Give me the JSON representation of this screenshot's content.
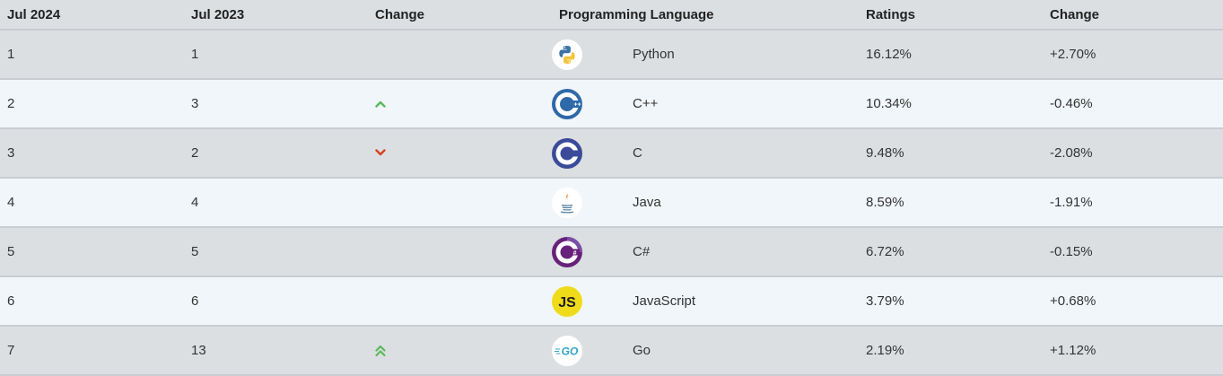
{
  "headers": {
    "current": "Jul 2024",
    "previous": "Jul 2023",
    "change": "Change",
    "language": "Programming Language",
    "ratings": "Ratings",
    "change_pct": "Change"
  },
  "rows": [
    {
      "current": "1",
      "previous": "1",
      "trend": "none",
      "icon": "python-logo-icon",
      "language": "Python",
      "rating": "16.12%",
      "change": "+2.70%"
    },
    {
      "current": "2",
      "previous": "3",
      "trend": "up",
      "icon": "cpp-logo-icon",
      "language": "C++",
      "rating": "10.34%",
      "change": "-0.46%"
    },
    {
      "current": "3",
      "previous": "2",
      "trend": "down",
      "icon": "c-logo-icon",
      "language": "C",
      "rating": "9.48%",
      "change": "-2.08%"
    },
    {
      "current": "4",
      "previous": "4",
      "trend": "none",
      "icon": "java-logo-icon",
      "language": "Java",
      "rating": "8.59%",
      "change": "-1.91%"
    },
    {
      "current": "5",
      "previous": "5",
      "trend": "none",
      "icon": "csharp-logo-icon",
      "language": "C#",
      "rating": "6.72%",
      "change": "-0.15%"
    },
    {
      "current": "6",
      "previous": "6",
      "trend": "none",
      "icon": "javascript-logo-icon",
      "language": "JavaScript",
      "rating": "3.79%",
      "change": "+0.68%"
    },
    {
      "current": "7",
      "previous": "13",
      "trend": "double-up",
      "icon": "go-logo-icon",
      "language": "Go",
      "rating": "2.19%",
      "change": "+1.12%"
    }
  ],
  "colors": {
    "up_arrow": "#5cb85c",
    "down_arrow": "#d9411e",
    "header_bg": "#dcdfe2",
    "odd_row_bg": "#dcdfe2",
    "even_row_bg": "#f1f6fa"
  }
}
